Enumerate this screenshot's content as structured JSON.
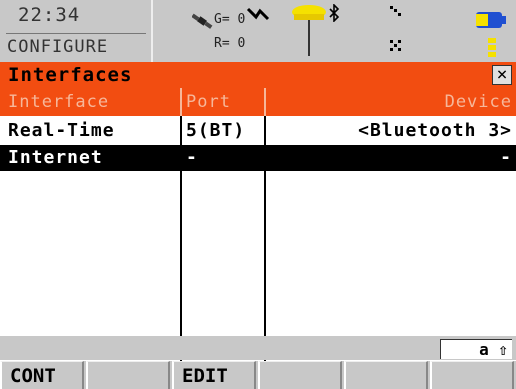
{
  "status": {
    "time": "22:34",
    "screen": "CONFIGURE",
    "gps_g": "G= 0",
    "gps_r": "R= 0",
    "icons": [
      "satellite-icon",
      "rtk-signal-icon",
      "antenna-icon",
      "bluetooth-icon",
      "network-icon",
      "battery-icon"
    ]
  },
  "title": "Interfaces",
  "close_label": "×",
  "table": {
    "headers": {
      "interface": "Interface",
      "port": "Port",
      "device": "Device"
    },
    "rows": [
      {
        "interface": "Real-Time",
        "port": "5(BT)",
        "device": "<Bluetooth 3>"
      },
      {
        "interface": "Internet",
        "port": "-",
        "device": "-"
      }
    ]
  },
  "input_mode": "a ⇧",
  "softkeys": [
    "CONT",
    "",
    "EDIT",
    "",
    "",
    ""
  ],
  "colors": {
    "accent": "#f24d11",
    "header_text": "#f6b79a",
    "bar": "#c8c8c8",
    "selected_row": "#000000"
  }
}
